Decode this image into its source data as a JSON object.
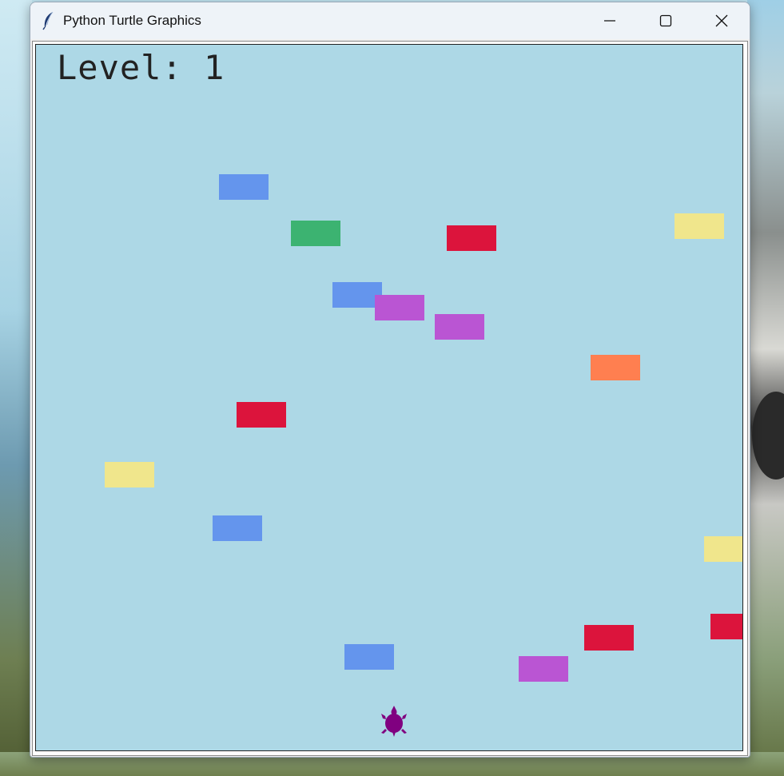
{
  "window": {
    "title": "Python Turtle Graphics",
    "icon": "feather-icon",
    "controls": [
      "minimize-icon",
      "maximize-icon",
      "close-icon"
    ]
  },
  "game": {
    "level_label": "Level: 1",
    "background_color": "#add8e6",
    "player": {
      "shape": "turtle",
      "color": "#800080"
    },
    "cars": [
      {
        "color": "#6495ed"
      },
      {
        "color": "#3cb371"
      },
      {
        "color": "#dc143c"
      },
      {
        "color": "#f0e68c"
      },
      {
        "color": "#6495ed"
      },
      {
        "color": "#ba55d3"
      },
      {
        "color": "#ba55d3"
      },
      {
        "color": "#ff7f50"
      },
      {
        "color": "#dc143c"
      },
      {
        "color": "#f0e68c"
      },
      {
        "color": "#6495ed"
      },
      {
        "color": "#f0e68c"
      },
      {
        "color": "#dc143c"
      },
      {
        "color": "#dc143c"
      },
      {
        "color": "#6495ed"
      },
      {
        "color": "#ba55d3"
      }
    ]
  }
}
